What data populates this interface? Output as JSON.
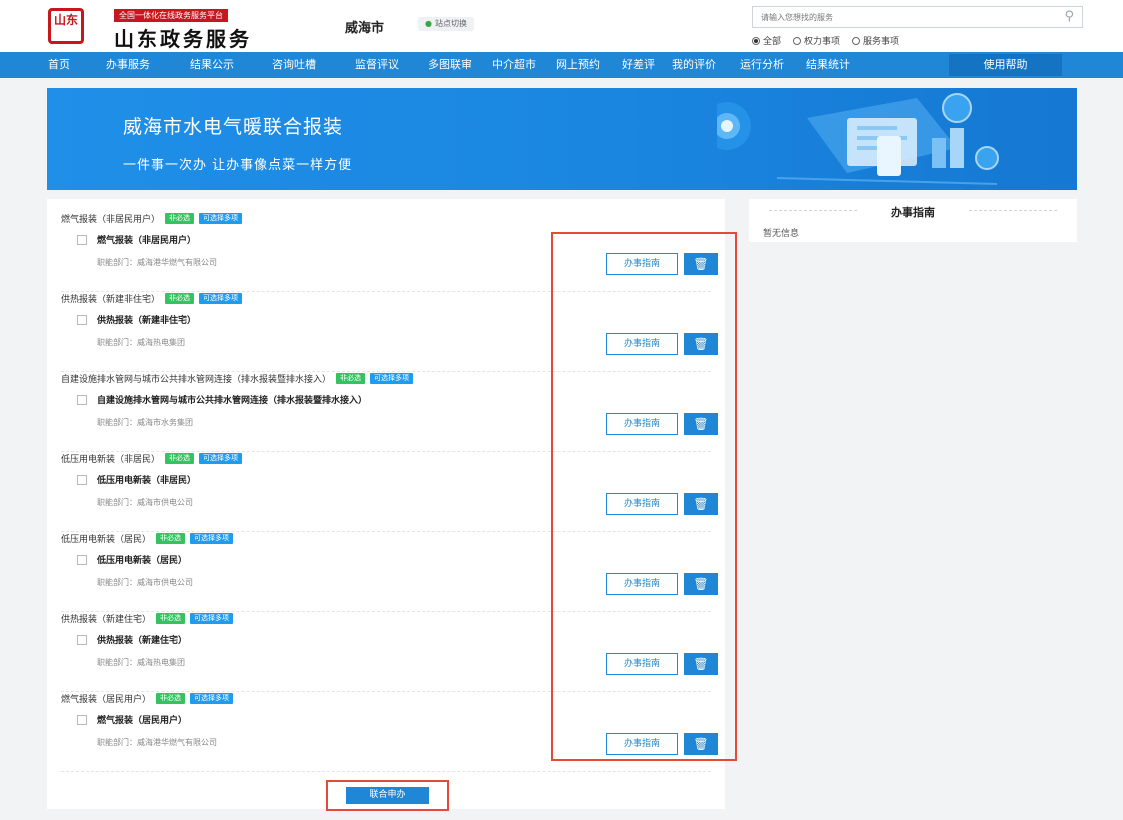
{
  "header": {
    "logo_text": "山东",
    "brand_top": "全国一体化在线政务服务平台",
    "brand_main": "山东政务服务",
    "city": "威海市",
    "switch_label": "站点切换",
    "search_placeholder": "请输入您想找的服务",
    "radio_options": [
      "全部",
      "权力事项",
      "服务事项"
    ],
    "radio_selected": "全部"
  },
  "nav": {
    "items": [
      "首页",
      "办事服务",
      "结果公示",
      "咨询吐槽",
      "监督评议",
      "多图联审",
      "中介超市",
      "网上预约",
      "好差评",
      "我的评价",
      "运行分析",
      "结果统计"
    ],
    "help_label": "使用帮助"
  },
  "banner": {
    "title": "威海市水电气暖联合报装",
    "subtitle": "一件事一次办   让办事像点菜一样方便"
  },
  "tags": {
    "optional": "非必选",
    "multi": "可选择多项"
  },
  "buttons": {
    "guide": "办事指南",
    "submit": "联合申办"
  },
  "groups": [
    {
      "header": "燃气报装（非居民用户）",
      "item": "燃气报装（非居民用户）",
      "dept": "职能部门：威海港华燃气有限公司"
    },
    {
      "header": "供热报装（新建非住宅）",
      "item": "供热报装（新建非住宅）",
      "dept": "职能部门：威海热电集团"
    },
    {
      "header": "自建设施排水管网与城市公共排水管网连接（排水报装暨排水接入）",
      "item": "自建设施排水管网与城市公共排水管网连接（排水报装暨排水接入）",
      "dept": "职能部门：威海市水务集团"
    },
    {
      "header": "低压用电新装（非居民）",
      "item": "低压用电新装（非居民）",
      "dept": "职能部门：威海市供电公司"
    },
    {
      "header": "低压用电新装（居民）",
      "item": "低压用电新装（居民）",
      "dept": "职能部门：威海市供电公司"
    },
    {
      "header": "供热报装（新建住宅）",
      "item": "供热报装（新建住宅）",
      "dept": "职能部门：威海热电集团"
    },
    {
      "header": "燃气报装（居民用户）",
      "item": "燃气报装（居民用户）",
      "dept": "职能部门：威海港华燃气有限公司"
    }
  ],
  "side": {
    "title": "办事指南",
    "empty": "暂无信息"
  },
  "colors": {
    "primary": "#1f87d6",
    "tag_green": "#34c360",
    "tag_blue": "#1f9cf0",
    "highlight_red": "#e64a37",
    "brand_red": "#c8161d"
  }
}
